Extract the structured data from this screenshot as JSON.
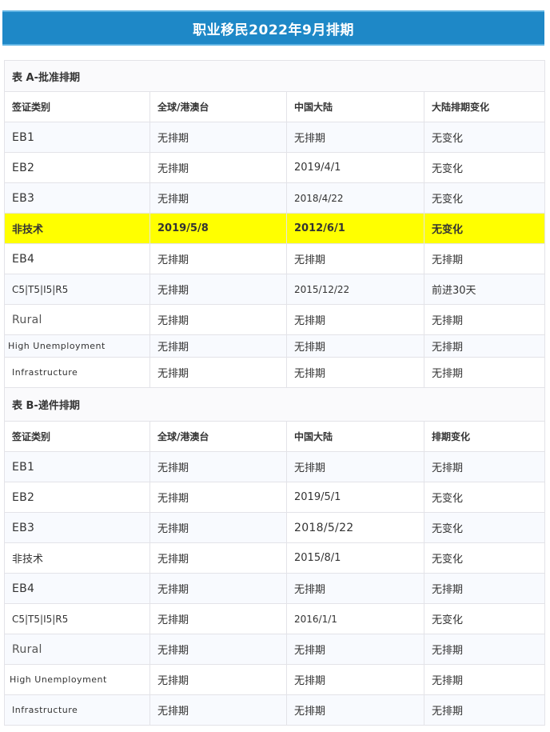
{
  "title": "职业移民2022年9月排期",
  "table_a": {
    "caption": "表 A-批准排期",
    "headers": [
      "签证类别",
      "全球/港澳台",
      "中国大陆",
      "大陆排期变化"
    ],
    "rows": [
      [
        "EB1",
        "无排期",
        "无排期",
        "无变化"
      ],
      [
        "EB2",
        "无排期",
        "2019/4/1",
        "无变化"
      ],
      [
        "EB3",
        "无排期",
        "2018/4/22",
        "无变化"
      ],
      [
        "非技术",
        "2019/5/8",
        "2012/6/1",
        "无变化"
      ],
      [
        "EB4",
        "无排期",
        "无排期",
        "无排期"
      ],
      [
        "C5|T5|I5|R5",
        "无排期",
        "2015/12/22",
        "前进30天"
      ],
      [
        "Rural",
        "无排期",
        "无排期",
        "无排期"
      ],
      [
        "High Unemployment",
        "无排期",
        "无排期",
        "无排期"
      ],
      [
        "Infrastructure",
        "无排期",
        "无排期",
        "无排期"
      ]
    ]
  },
  "table_b": {
    "caption": "表 B-递件排期",
    "headers": [
      "签证类别",
      "全球/港澳台",
      "中国大陆",
      "排期变化"
    ],
    "rows": [
      [
        "EB1",
        "无排期",
        "无排期",
        "无排期"
      ],
      [
        "EB2",
        "无排期",
        "2019/5/1",
        "无变化"
      ],
      [
        "EB3",
        "无排期",
        "2018/5/22",
        "无变化"
      ],
      [
        "非技术",
        "无排期",
        "2015/8/1",
        "无变化"
      ],
      [
        "EB4",
        "无排期",
        "无排期",
        "无排期"
      ],
      [
        "C5|T5|I5|R5",
        "无排期",
        "2016/1/1",
        "无变化"
      ],
      [
        "Rural",
        "无排期",
        "无排期",
        "无排期"
      ],
      [
        "High Unemployment",
        "无排期",
        "无排期",
        "无排期"
      ],
      [
        "Infrastructure",
        "无排期",
        "无排期",
        "无排期"
      ]
    ]
  },
  "colors": {
    "title_bg": "#1e88c7",
    "highlight": "#ffff00"
  }
}
